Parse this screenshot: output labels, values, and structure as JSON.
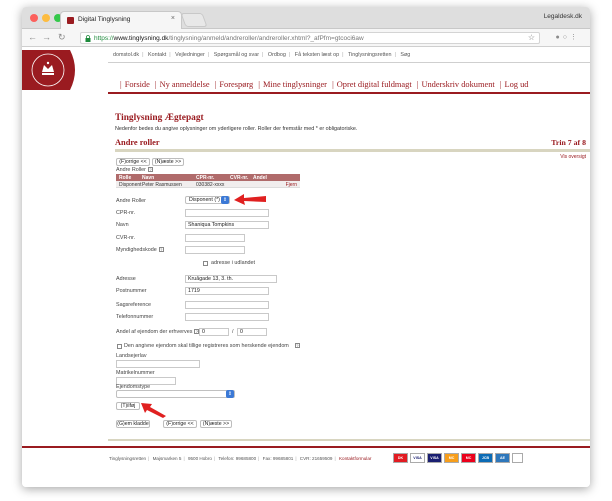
{
  "browser": {
    "tab_title": "Digital Tinglysning",
    "tab_close": "×",
    "profile": "Legaldesk.dk",
    "url_scheme": "https://",
    "url_host": "www.tinglysning.dk",
    "url_path": "/tinglysning/anmeld/andreroller/andreroller.xhtml?_afPfm=gtcoci6aw",
    "back_icon": "arrow-left",
    "forward_icon": "arrow-right",
    "reload_icon": "reload",
    "star_icon": "star"
  },
  "site": {
    "logo_text": "TINGLYSNINGSRETTEN",
    "top_links": [
      "domstol.dk",
      "Kontakt",
      "Vejledninger",
      "Spørgsmål og svar",
      "Ordbog",
      "Få teksten læst op",
      "Tinglysningsretten",
      "Søg"
    ],
    "main_nav": [
      "Forside",
      "Ny anmeldelse",
      "Forespørg",
      "Mine tinglysninger",
      "Opret digital fuldmagt",
      "Underskriv dokument",
      "Log ud"
    ]
  },
  "page": {
    "title": "Tinglysning Ægtepagt",
    "intro": "Nedenfor bedes du angive oplysninger om yderligere roller. Roller der fremstår med * er obligatoriske.",
    "section_title": "Andre roller",
    "step": "Trin 7 af 8",
    "vis_oversigt": "Vis oversigt",
    "btn_prev": "(F)orrige <<",
    "btn_next": "(N)æste >>",
    "andre_roller_label": "Andre Roller",
    "help_glyph": "?",
    "table": {
      "headers": [
        "Rolle",
        "Navn",
        "CPR-nr.",
        "CVR-nr.",
        "Andel"
      ],
      "rows": [
        {
          "rolle": "Disponent",
          "navn": "Peter Rasmussen",
          "cpr": "030382-xxxx",
          "cvr": "",
          "andel": "",
          "action": "Fjern"
        }
      ]
    },
    "form": {
      "andre_roller_select_label": "Andre Roller",
      "andre_roller_value": "Disponent (*)",
      "cpr_label": "CPR-nr.",
      "cpr_value": "",
      "navn_label": "Navn",
      "navn_value": "Shaniqua Tompkins",
      "cvr_label": "CVR-nr.",
      "cvr_value": "",
      "myndighedskode_label": "Myndighedskode",
      "myndighedskode_value": "",
      "udland_label": "adresse i udlandet",
      "adresse_label": "Adresse",
      "adresse_value": "Kruågade 13, 3. th.",
      "postnummer_label": "Postnummer",
      "postnummer_value": "1719",
      "sagsreference_label": "Sagsreference",
      "sagsreference_value": "",
      "telefonnummer_label": "Telefonnummer",
      "telefonnummer_value": "",
      "andel_label": "Andel af ejendom der erhverves",
      "andel_num": "0",
      "andel_slash": "/",
      "andel_den": "0",
      "herskende_label": "Den angivne ejendom skal tillige registreres som herskende ejendom",
      "landsejerlav_label": "Landsejerlav",
      "landsejerlav_value": "",
      "matrikelnummer_label": "Matrikelnummer",
      "matrikelnummer_value": "",
      "ejendomstype_label": "Ejendomstype",
      "ejendomstype_value": "",
      "tilfoej": "(T)ilføj",
      "gem_kladde": "(G)em kladde"
    }
  },
  "footer": {
    "items": [
      "Tinglysningsretten",
      "Majsmarken 5",
      "9500 Hobro",
      "Telefon: 99685800",
      "Fax: 99685801",
      "CVR: 21659509"
    ],
    "kontakt": "Kontaktformular",
    "cards": [
      "DK",
      "VISA",
      "VISA",
      "MC",
      "MC",
      "JCB",
      "AE",
      " "
    ]
  },
  "colors": {
    "brand_red": "#9a1b20",
    "table_header": "#b06b6b",
    "arrow_red": "#e02020",
    "select_blue": "#3b79d6"
  }
}
